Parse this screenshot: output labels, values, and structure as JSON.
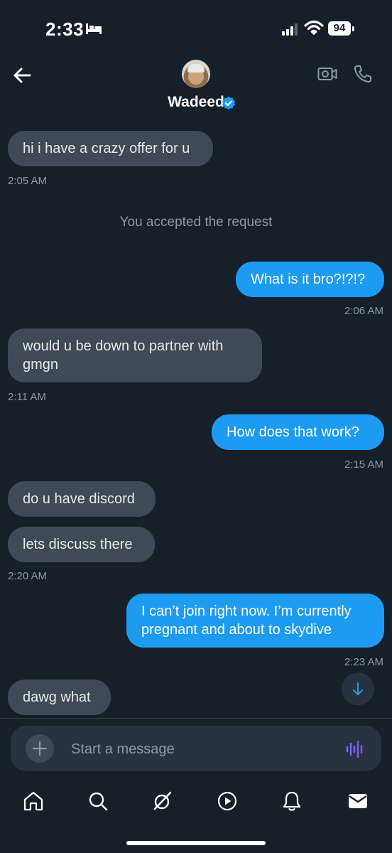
{
  "status_bar": {
    "time": "2:33",
    "battery": "94"
  },
  "header": {
    "contact_name": "Wadeed",
    "verified": true
  },
  "messages": [
    {
      "direction": "in",
      "text": "hi i have a crazy offer for u",
      "time": "2:05 AM"
    },
    {
      "direction": "system",
      "text": "You accepted the request"
    },
    {
      "direction": "out",
      "text": "What is it bro?!?!?",
      "time": "2:06 AM"
    },
    {
      "direction": "in",
      "text": "would  u be down to partner with gmgn",
      "time": "2:11 AM"
    },
    {
      "direction": "out",
      "text": "How does that work?",
      "time": "2:15 AM"
    },
    {
      "direction": "in",
      "text": "do u have discord"
    },
    {
      "direction": "in",
      "text": "lets discuss there",
      "time": "2:20 AM"
    },
    {
      "direction": "out",
      "text": "I can’t join right now. I’m currently pregnant and about to skydive",
      "time": "2:23 AM"
    },
    {
      "direction": "in",
      "text": "dawg what"
    }
  ],
  "composer": {
    "placeholder": "Start a message"
  },
  "bottom_nav": {
    "items": [
      {
        "icon": "home-icon"
      },
      {
        "icon": "search-icon"
      },
      {
        "icon": "grok-icon"
      },
      {
        "icon": "video-play-icon"
      },
      {
        "icon": "bell-icon"
      },
      {
        "icon": "mail-icon"
      }
    ]
  },
  "colors": {
    "background": "#15202b",
    "incoming_bubble": "#3e4a57",
    "outgoing_bubble": "#1d9bf0",
    "secondary_text": "#8b98a5",
    "voice_accent": "#7856ff"
  }
}
